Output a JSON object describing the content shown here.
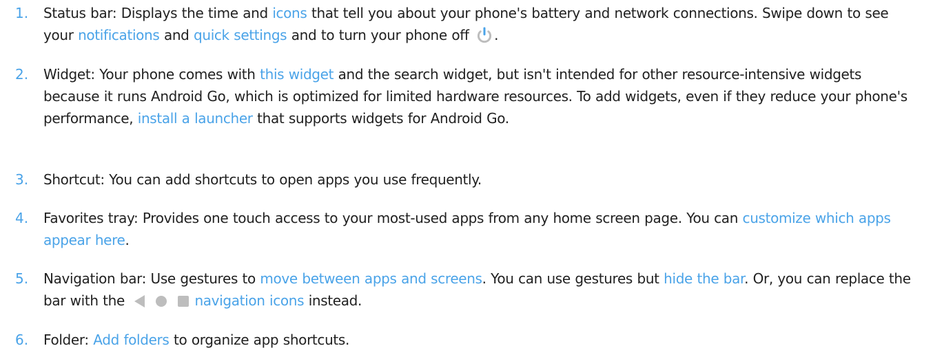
{
  "colors": {
    "link": "#4aa3e8",
    "number": "#4aa3e8",
    "text": "#212121",
    "nav_icon": "#bdbdbd"
  },
  "items": [
    {
      "number": "1.",
      "t1": "Status bar: Displays the time and ",
      "l1": "icons",
      "t2": " that tell you about your phone's battery and network connections. Swipe down to see your ",
      "l2": "notifications",
      "t3": " and ",
      "l3": "quick settings",
      "t4": " and to turn your phone off ",
      "icon": "power-icon",
      "t5": "."
    },
    {
      "number": "2.",
      "t1": "Widget: Your phone comes with ",
      "l1": "this widget",
      "t2": " and the search widget, but isn't intended for other resource-intensive widgets because it runs Android Go, which is optimized for limited hardware resources. To add widgets, even if they reduce your phone's performance, ",
      "l2": "install a launcher",
      "t3": " that supports widgets for Android Go."
    },
    {
      "number": "3.",
      "t1": "Shortcut: You can add shortcuts to open apps you use frequently."
    },
    {
      "number": "4.",
      "t1": "Favorites tray: Provides one touch access to your most-used apps from any home screen page. You can ",
      "l1": "customize which apps appear here",
      "t2": "."
    },
    {
      "number": "5.",
      "t1": "Navigation bar: Use gestures to ",
      "l1": "move between apps and screens",
      "t2": ". You can use gestures but ",
      "l2": "hide the bar",
      "t3": ". Or, you can replace the bar with the ",
      "icons": [
        "back-icon",
        "home-icon",
        "recents-icon"
      ],
      "l3": "navigation icons",
      "t4": " instead."
    },
    {
      "number": "6.",
      "t1": "Folder: ",
      "l1": "Add folders",
      "t2": " to organize app shortcuts."
    }
  ]
}
